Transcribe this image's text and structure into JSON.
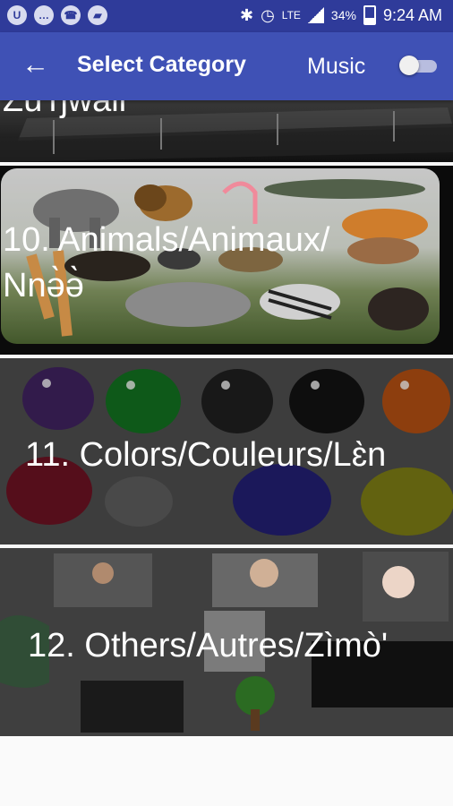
{
  "status_bar": {
    "network_label": "LTE",
    "battery_percent": "34%",
    "time": "9:24 AM",
    "icons": [
      "app-icon",
      "messages-icon",
      "whatsapp-icon",
      "store-icon",
      "bluetooth-icon",
      "alarm-icon",
      "signal-icon",
      "battery-icon"
    ]
  },
  "app_bar": {
    "title": "Select Category",
    "music_label": "Music",
    "music_enabled": false
  },
  "categories": [
    {
      "label": "Zu'ŋwàlǐ"
    },
    {
      "label": "10. Animals/Animaux/ Nnə̀ə̀"
    },
    {
      "label": "11. Colors/Couleurs/Lɛ̀n"
    },
    {
      "label": "12. Others/Autres/Zìmò'"
    }
  ]
}
